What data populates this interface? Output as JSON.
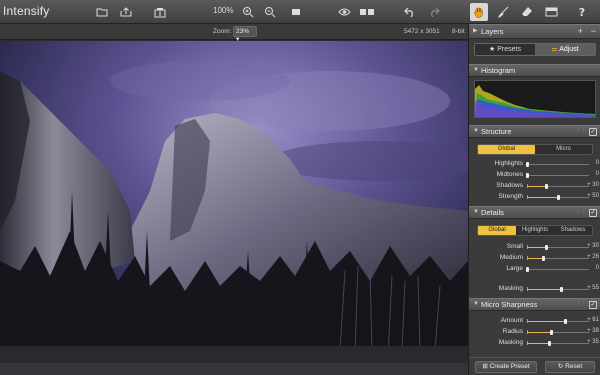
{
  "app": {
    "title": "Intensify"
  },
  "toolbar": {
    "zoom_percent": "100%",
    "tools": [
      "open-icon",
      "share-icon",
      "presets-icon",
      "zoom-in-icon",
      "zoom-out-icon",
      "fit-icon",
      "preview-eye-icon",
      "compare-icon",
      "undo-icon",
      "redo-icon",
      "hand-icon",
      "brush-icon",
      "eraser-icon",
      "mask-icon",
      "help-icon"
    ]
  },
  "statusbar": {
    "zoom_label": "Zoom:",
    "zoom_value": "23%",
    "dimensions": "5472 x 3051",
    "bit_depth": "8-bit"
  },
  "panel": {
    "layers_title": "Layers",
    "tabs": {
      "presets": "Presets",
      "adjust": "Adjust"
    },
    "histogram_title": "Histogram",
    "structure": {
      "title": "Structure",
      "segments": [
        "Global",
        "Micro"
      ],
      "sliders": [
        {
          "label": "Highlights",
          "value": "0",
          "level": 0
        },
        {
          "label": "Midtones",
          "value": "0",
          "level": 0
        },
        {
          "label": "Shadows",
          "value": "+ 30",
          "level": 30
        },
        {
          "label": "Strength",
          "value": "+ 50",
          "level": 50
        }
      ]
    },
    "details": {
      "title": "Details",
      "segments": [
        "Global",
        "Highlights",
        "Shadows"
      ],
      "sliders": [
        {
          "label": "Small",
          "value": "+ 30",
          "level": 30
        },
        {
          "label": "Medium",
          "value": "+ 26",
          "level": 26
        },
        {
          "label": "Large",
          "value": "0",
          "level": 0
        },
        {
          "label": "Masking",
          "value": "+ 55",
          "level": 55
        }
      ]
    },
    "micro_sharpness": {
      "title": "Micro Sharpness",
      "sliders": [
        {
          "label": "Amount",
          "value": "+ 61",
          "level": 61
        },
        {
          "label": "Radius",
          "value": "+ 38",
          "level": 38
        },
        {
          "label": "Masking",
          "value": "+ 35",
          "level": 35
        }
      ]
    },
    "buttons": {
      "create_preset": "Create Preset",
      "reset": "Reset"
    }
  },
  "colors": {
    "accent": "#f0c040",
    "slider_fill": "#e8b84a"
  }
}
